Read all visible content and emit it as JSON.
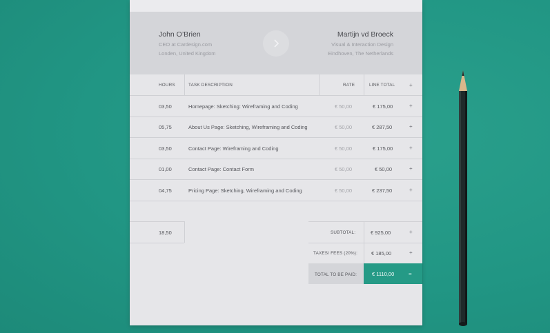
{
  "from": {
    "name": "John O’Brien",
    "line1": "CEO at Cardesign.com",
    "line2": "Londen, United Kingdom"
  },
  "to": {
    "name": "Martijn vd Broeck",
    "line1": "Visual & Interaction Design",
    "line2": "Eindhoven, The Netherlands"
  },
  "table": {
    "headers": {
      "hours": "HOURS",
      "task": "TASK DESCRIPTION",
      "rate": "RATE",
      "line_total": "LINE TOTAL",
      "add": "+"
    },
    "rows": [
      {
        "hours": "03,50",
        "task": "Homepage: Sketching: Wireframing and Coding",
        "rate": "€ 50,00",
        "total": "€ 175,00",
        "action": "+"
      },
      {
        "hours": "05,75",
        "task": "About Us Page: Sketching, Wireframing and Coding",
        "rate": "€ 50,00",
        "total": "€ 287,50",
        "action": "+"
      },
      {
        "hours": "03,50",
        "task": "Contact Page: Wireframing and Coding",
        "rate": "€ 50,00",
        "total": "€ 175,00",
        "action": "+"
      },
      {
        "hours": "01,00",
        "task": "Contact Page: Contact Form",
        "rate": "€ 50,00",
        "total": "€ 50,00",
        "action": "+"
      },
      {
        "hours": "04,75",
        "task": "Pricing Page: Sketching,  Wireframing and Coding",
        "rate": "€ 50,00",
        "total": "€ 237,50",
        "action": "+"
      }
    ]
  },
  "summary": {
    "total_hours": "18,50",
    "subtotal_label": "SUBTOTAL:",
    "subtotal_value": "€ 925,00",
    "subtotal_action": "+",
    "taxes_label": "TAXES/ FEES (20%):",
    "taxes_value": "€ 185,00",
    "taxes_action": "+",
    "total_label": "TOTAL TO BE PAID:",
    "total_value": "€ 1110,00",
    "total_action": "="
  },
  "colors": {
    "accent": "#259a86",
    "background": "#219684",
    "paper": "#e6e6e9",
    "header": "#d4d5d9"
  },
  "icons": {
    "next": "chevron-right-icon"
  }
}
